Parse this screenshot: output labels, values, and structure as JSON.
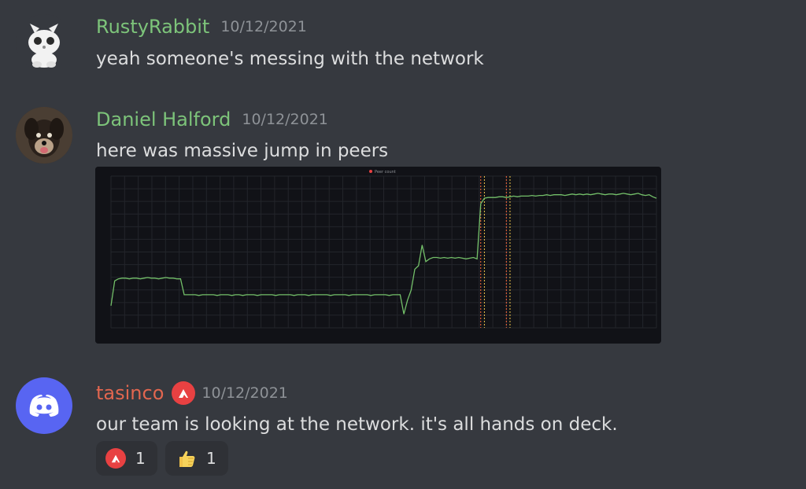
{
  "messages": [
    {
      "author": "RustyRabbit",
      "timestamp": "10/12/2021",
      "text": "yeah someone's messing with the network",
      "author_color": "#7dc47a",
      "avatar_icon": "white-bunny-mascot-icon"
    },
    {
      "author": "Daniel Halford",
      "timestamp": "10/12/2021",
      "text": "here was massive jump in peers",
      "author_color": "#7dc47a",
      "avatar_icon": "dog-photo-avatar",
      "attachment": {
        "type": "chart-screenshot",
        "legend": "Peer count"
      }
    },
    {
      "author": "tasinco",
      "timestamp": "10/12/2021",
      "text": "our team is looking at the network.  it's all hands on deck.",
      "author_color": "#e2664f",
      "avatar_icon": "discord-logo-icon",
      "badge_icon": "avalanche-logo-icon",
      "reactions": [
        {
          "icon": "avalanche-logo-icon",
          "count": "1"
        },
        {
          "icon": "thumbs-up-icon",
          "count": "1"
        }
      ]
    }
  ],
  "chart_data": {
    "type": "line",
    "legend": [
      "Peer count"
    ],
    "series": [
      {
        "name": "Peer count",
        "color": "#73bf69",
        "values": [
          2,
          38,
          41,
          42,
          42,
          41,
          42,
          42,
          41,
          42,
          43,
          42,
          42,
          41,
          42,
          43,
          42,
          42,
          41,
          41,
          18,
          18,
          18,
          18,
          17,
          18,
          18,
          18,
          18,
          17,
          18,
          18,
          18,
          17,
          18,
          18,
          17,
          18,
          18,
          18,
          17,
          18,
          18,
          18,
          18,
          17,
          18,
          18,
          18,
          18,
          17,
          18,
          18,
          18,
          17,
          18,
          18,
          18,
          18,
          18,
          17,
          18,
          18,
          18,
          18,
          17,
          18,
          18,
          18,
          18,
          18,
          17,
          18,
          18,
          18,
          18,
          17,
          18,
          18,
          18,
          -10,
          10,
          25,
          55,
          60,
          90,
          66,
          70,
          72,
          72,
          71,
          72,
          71,
          72,
          71,
          72,
          71,
          70,
          71,
          72,
          70,
          150,
          158,
          159,
          159,
          159,
          160,
          160,
          159,
          160,
          161,
          160,
          161,
          161,
          161,
          162,
          161,
          162,
          162,
          163,
          162,
          163,
          163,
          163,
          162,
          163,
          164,
          163,
          164,
          163,
          164,
          163,
          164,
          165,
          164,
          163,
          164,
          164,
          163,
          164,
          165,
          164,
          163,
          164,
          165,
          163,
          162,
          163,
          160,
          158
        ]
      }
    ],
    "ylim": [
      -30,
      190
    ],
    "markers": [
      {
        "index": 101,
        "color": "#ff6a3d"
      },
      {
        "index": 102,
        "color": "#f2c94c"
      },
      {
        "index": 108,
        "color": "#ff6a3d"
      },
      {
        "index": 109,
        "color": "#f2c94c"
      }
    ],
    "grid": true,
    "background": "#111217"
  }
}
